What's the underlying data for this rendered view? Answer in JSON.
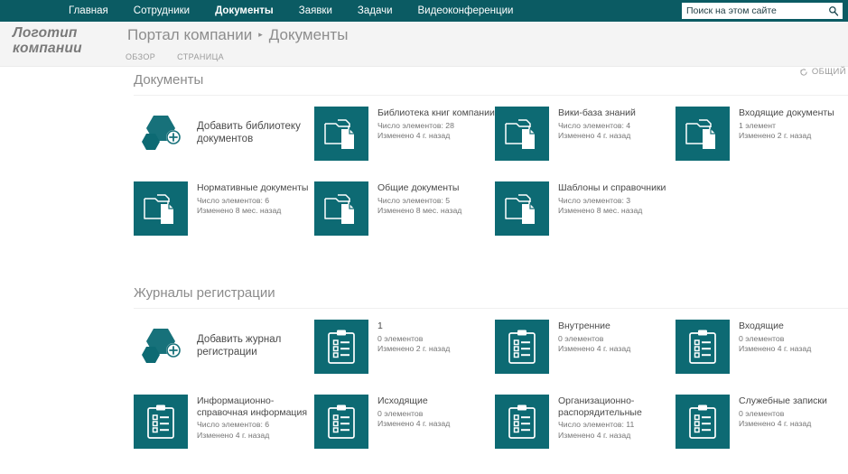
{
  "topnav": {
    "items": [
      {
        "label": "Главная",
        "active": false
      },
      {
        "label": "Сотрудники",
        "active": false
      },
      {
        "label": "Документы",
        "active": true
      },
      {
        "label": "Заявки",
        "active": false
      },
      {
        "label": "Задачи",
        "active": false
      },
      {
        "label": "Видеоконференции",
        "active": false
      }
    ],
    "search": {
      "placeholder": "Поиск на этом сайте",
      "value": "",
      "icon": "search-icon"
    }
  },
  "header": {
    "logo": "Логотип компании",
    "breadcrumb": {
      "site": "Портал компании",
      "separator": "▸",
      "page": "Документы"
    },
    "ribbon_tabs": [
      {
        "label": "ОБЗОР"
      },
      {
        "label": "СТРАНИЦА"
      }
    ],
    "share": {
      "label": "ОБЩИЙ",
      "icon": "share-circle-icon"
    }
  },
  "colors": {
    "suite_bar": "#0b5b63",
    "tile": "#0d6a73",
    "header_band": "#f4f4f4",
    "page_bg": "#ffffff",
    "text_muted": "#8b8b8b"
  },
  "sections": [
    {
      "title": "Документы",
      "add_tile": {
        "label": "Добавить библиотеку документов",
        "icon": "add-hexagon-icon"
      },
      "tiles": [
        {
          "icon": "document-library-icon",
          "name": "Библиотека книг компании",
          "count": "Число элементов: 28",
          "modified": "Изменено 4 г. назад"
        },
        {
          "icon": "document-library-icon",
          "name": "Вики-база знаний",
          "count": "Число элементов: 4",
          "modified": "Изменено 4 г. назад"
        },
        {
          "icon": "document-library-icon",
          "name": "Входящие документы",
          "count": "1 элемент",
          "modified": "Изменено 2 г. назад"
        },
        {
          "icon": "document-library-icon",
          "name": "Нормативные документы",
          "count": "Число элементов: 6",
          "modified": "Изменено 8 мес. назад"
        },
        {
          "icon": "document-library-icon",
          "name": "Общие документы",
          "count": "Число элементов: 5",
          "modified": "Изменено 8 мес. назад"
        },
        {
          "icon": "document-library-icon",
          "name": "Шаблоны и справочники",
          "count": "Число элементов: 3",
          "modified": "Изменено 8 мес. назад"
        }
      ]
    },
    {
      "title": "Журналы регистрации",
      "add_tile": {
        "label": "Добавить журнал регистрации",
        "icon": "add-hexagon-icon"
      },
      "tiles": [
        {
          "icon": "list-clipboard-icon",
          "name": "1",
          "count": "0 элементов",
          "modified": "Изменено 2 г. назад"
        },
        {
          "icon": "list-clipboard-icon",
          "name": "Внутренние",
          "count": "0 элементов",
          "modified": "Изменено 4 г. назад"
        },
        {
          "icon": "list-clipboard-icon",
          "name": "Входящие",
          "count": "0 элементов",
          "modified": "Изменено 4 г. назад"
        },
        {
          "icon": "list-clipboard-icon",
          "name": "Информационно-справочная информация",
          "count": "Число элементов: 6",
          "modified": "Изменено 4 г. назад"
        },
        {
          "icon": "list-clipboard-icon",
          "name": "Исходящие",
          "count": "0 элементов",
          "modified": "Изменено 4 г. назад"
        },
        {
          "icon": "list-clipboard-icon",
          "name": "Организационно-распорядительные",
          "count": "Число элементов: 11",
          "modified": "Изменено 4 г. назад"
        },
        {
          "icon": "list-clipboard-icon",
          "name": "Служебные записки",
          "count": "0 элементов",
          "modified": "Изменено 4 г. назад"
        }
      ]
    }
  ]
}
